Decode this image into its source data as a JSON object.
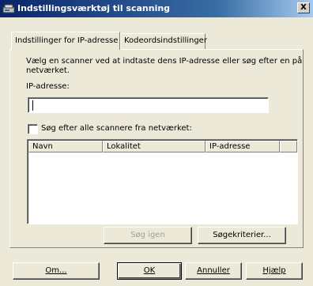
{
  "window": {
    "title": "Indstillingsværktøj til scanning",
    "close_label": "X"
  },
  "tabs": [
    {
      "label": "Indstillinger for IP-adresse",
      "active": true
    },
    {
      "label": "Kodeordsindstillinger",
      "active": false
    }
  ],
  "ip_panel": {
    "instruction_line1": "Vælg en scanner ved at indtaste dens IP-adresse eller søg efter en på",
    "instruction_line2": "netværket.",
    "ip_label": "IP-adresse:",
    "ip_value": "",
    "search_checkbox_label": "Søg efter alle scannere fra netværket:",
    "search_checkbox_checked": false,
    "list_columns": [
      "Navn",
      "Lokalitet",
      "IP-adresse"
    ],
    "list_rows": [],
    "search_again_label": "Søg igen",
    "search_criteria_label": "Søgekriterier..."
  },
  "footer": {
    "about_label": "Om...",
    "ok_label": "OK",
    "cancel_label": "Annuller",
    "help_label": "Hjælp"
  }
}
